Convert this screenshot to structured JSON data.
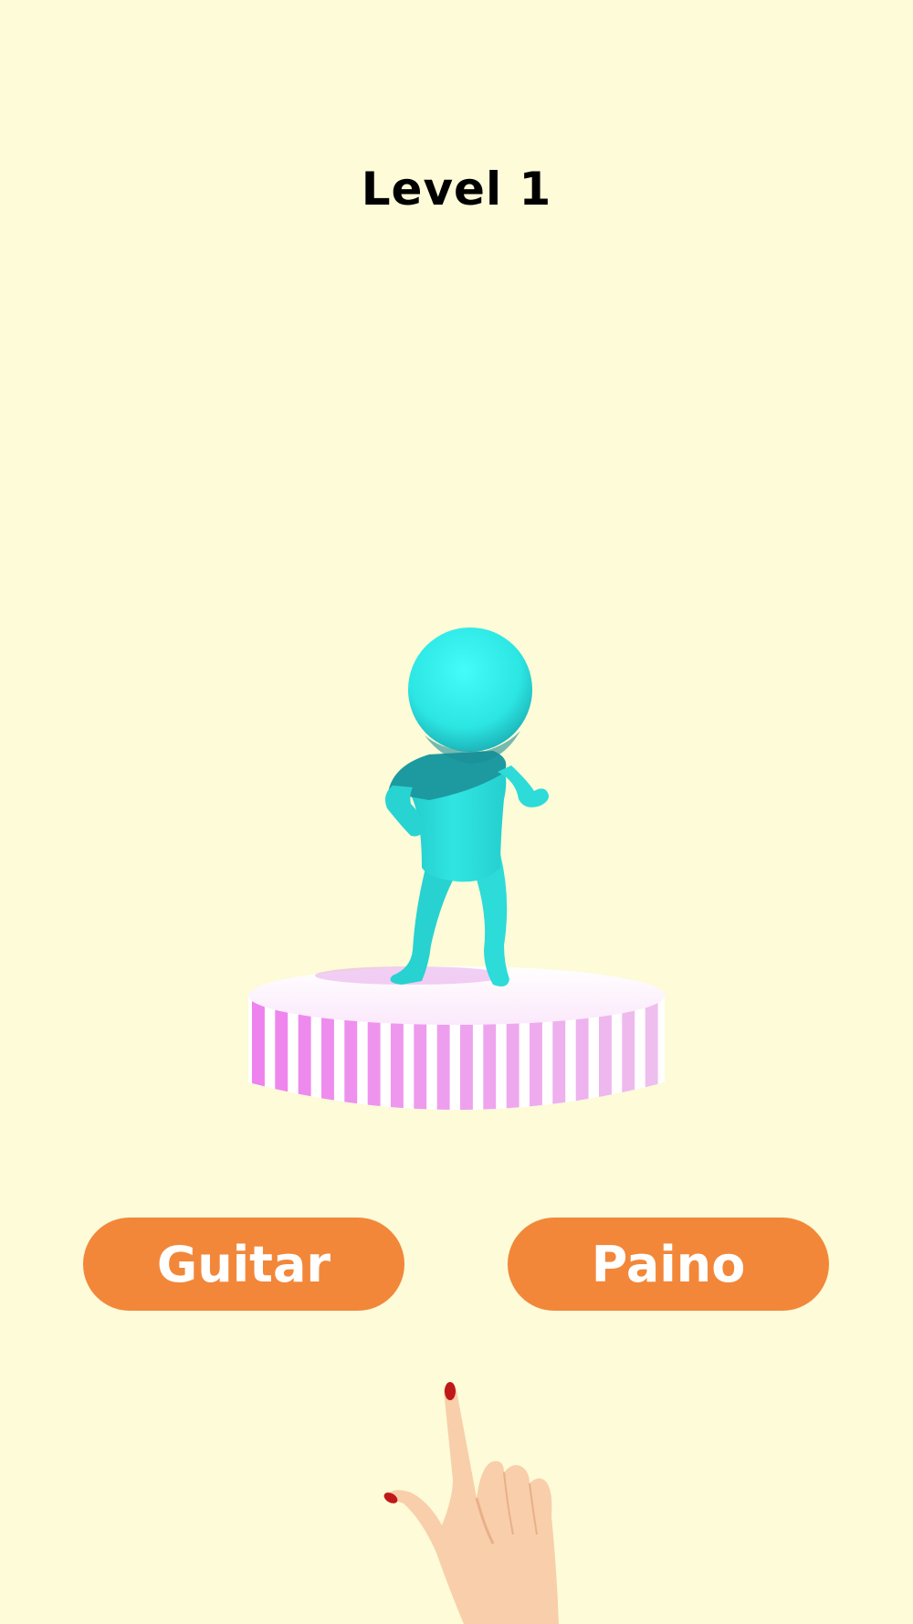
{
  "hud": {
    "level_label": "Level 1"
  },
  "choices": [
    {
      "label": "Guitar"
    },
    {
      "label": "Paino"
    }
  ],
  "colors": {
    "background": "#fdfbd8",
    "button": "#f2873a",
    "button_text": "#ffffff",
    "character": "#2fe3e0",
    "pedestal_stripe": "#ee82ee"
  },
  "icons": {
    "tutorial_hand": "pointing-hand-icon"
  }
}
